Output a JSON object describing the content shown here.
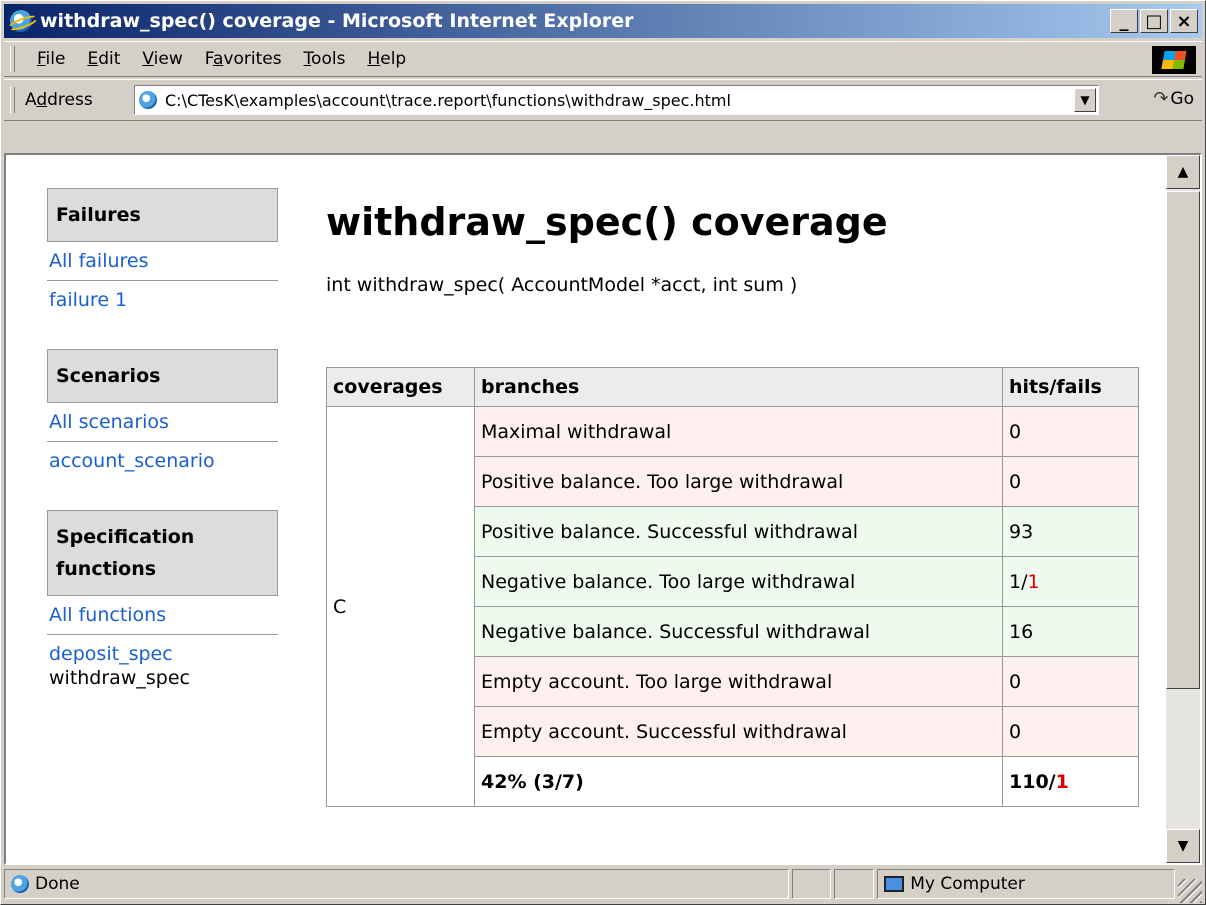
{
  "window": {
    "title": "withdraw_spec() coverage - Microsoft Internet Explorer",
    "buttons": {
      "minimize": "_",
      "maximize": "□",
      "close": "×"
    }
  },
  "menubar": {
    "items": [
      {
        "pre": "",
        "key": "F",
        "post": "ile"
      },
      {
        "pre": "",
        "key": "E",
        "post": "dit"
      },
      {
        "pre": "",
        "key": "V",
        "post": "iew"
      },
      {
        "pre": "F",
        "key": "a",
        "post": "vorites"
      },
      {
        "pre": "",
        "key": "T",
        "post": "ools"
      },
      {
        "pre": "",
        "key": "H",
        "post": "elp"
      }
    ]
  },
  "addressbar": {
    "label_pre": "A",
    "label_key": "d",
    "label_post": "dress",
    "url": "C:\\CTesK\\examples\\account\\trace.report\\functions\\withdraw_spec.html",
    "go": "Go"
  },
  "sidebar": {
    "failures": {
      "heading": "Failures",
      "all": "All failures",
      "items": [
        "failure 1"
      ]
    },
    "scenarios": {
      "heading": "Scenarios",
      "all": "All scenarios",
      "items": [
        "account_scenario"
      ]
    },
    "functions": {
      "heading": "Specification functions",
      "all": "All functions",
      "items": [
        "deposit_spec"
      ],
      "current": "withdraw_spec"
    }
  },
  "main": {
    "title": "withdraw_spec() coverage",
    "signature": "int withdraw_spec( AccountModel *acct, int sum )",
    "table": {
      "headers": {
        "coverages": "coverages",
        "branches": "branches",
        "hits": "hits/fails"
      },
      "coverage": "C",
      "rows": [
        {
          "branch": "Maximal withdrawal",
          "hits": "0",
          "fails": ""
        },
        {
          "branch": "Positive balance. Too large withdrawal",
          "hits": "0",
          "fails": ""
        },
        {
          "branch": "Positive balance. Successful withdrawal",
          "hits": "93",
          "fails": ""
        },
        {
          "branch": "Negative balance. Too large withdrawal",
          "hits": "1/",
          "fails": "1"
        },
        {
          "branch": "Negative balance. Successful withdrawal",
          "hits": "16",
          "fails": ""
        },
        {
          "branch": "Empty account. Too large withdrawal",
          "hits": "0",
          "fails": ""
        },
        {
          "branch": "Empty account. Successful withdrawal",
          "hits": "0",
          "fails": ""
        }
      ],
      "total": {
        "branch": "42% (3/7)",
        "hits": "110/",
        "fails": "1"
      }
    }
  },
  "status": {
    "text": "Done",
    "zone": "My Computer"
  },
  "colors": {
    "link": "#1a5fd0",
    "fail": "#e00000",
    "uncovered_row": "#fdf0ef",
    "covered_row": "#effaee"
  }
}
